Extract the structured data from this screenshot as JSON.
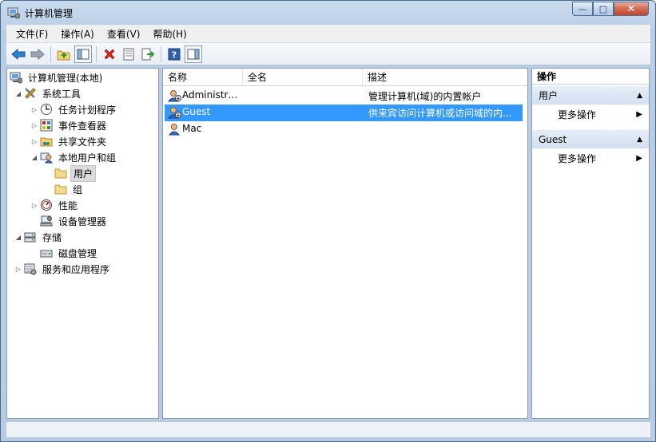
{
  "window": {
    "title": "计算机管理",
    "controls": {
      "minimize": "—",
      "maximize": "□",
      "close": "✕"
    }
  },
  "menu": [
    "文件(F)",
    "操作(A)",
    "查看(V)",
    "帮助(H)"
  ],
  "toolbar": {
    "buttons": [
      "back-icon",
      "forward-icon",
      "up-folder-icon",
      "show-hide-tree-icon",
      "delete-icon",
      "properties-icon",
      "export-icon",
      "help-icon",
      "show-hide-action-pane-icon"
    ]
  },
  "tree": {
    "items": [
      {
        "label": "计算机管理(本地)",
        "expander": "",
        "icon": "computer-management-icon"
      },
      {
        "label": "系统工具",
        "expander": "◢",
        "icon": "system-tools-icon"
      },
      {
        "label": "任务计划程序",
        "expander": "▷",
        "icon": "task-scheduler-icon"
      },
      {
        "label": "事件查看器",
        "expander": "▷",
        "icon": "event-viewer-icon"
      },
      {
        "label": "共享文件夹",
        "expander": "▷",
        "icon": "shared-folders-icon"
      },
      {
        "label": "本地用户和组",
        "expander": "◢",
        "icon": "local-users-groups-icon"
      },
      {
        "label": "用户",
        "expander": "",
        "icon": "folder-icon"
      },
      {
        "label": "组",
        "expander": "",
        "icon": "folder-icon"
      },
      {
        "label": "性能",
        "expander": "▷",
        "icon": "performance-icon"
      },
      {
        "label": "设备管理器",
        "expander": "",
        "icon": "device-manager-icon"
      },
      {
        "label": "存储",
        "expander": "◢",
        "icon": "storage-icon"
      },
      {
        "label": "磁盘管理",
        "expander": "",
        "icon": "disk-management-icon"
      },
      {
        "label": "服务和应用程序",
        "expander": "▷",
        "icon": "services-apps-icon"
      }
    ]
  },
  "list": {
    "columns": [
      "名称",
      "全名",
      "描述"
    ],
    "rows": [
      {
        "name": "Administrat...",
        "full_name": "",
        "description": "管理计算机(域)的内置帐户",
        "icon": "admin-user-icon"
      },
      {
        "name": "Guest",
        "full_name": "",
        "description": "供来宾访问计算机或访问域的内...",
        "icon": "disabled-user-icon"
      },
      {
        "name": "Mac",
        "full_name": "",
        "description": "",
        "icon": "user-icon"
      }
    ]
  },
  "actions": {
    "title": "操作",
    "sections": [
      {
        "header": "用户",
        "items": [
          "更多操作"
        ]
      },
      {
        "header": "Guest",
        "items": [
          "更多操作"
        ]
      }
    ]
  },
  "colors": {
    "selection": "#3399ff",
    "frame": "#b9cde5",
    "section_header": "#dbe6f4"
  }
}
